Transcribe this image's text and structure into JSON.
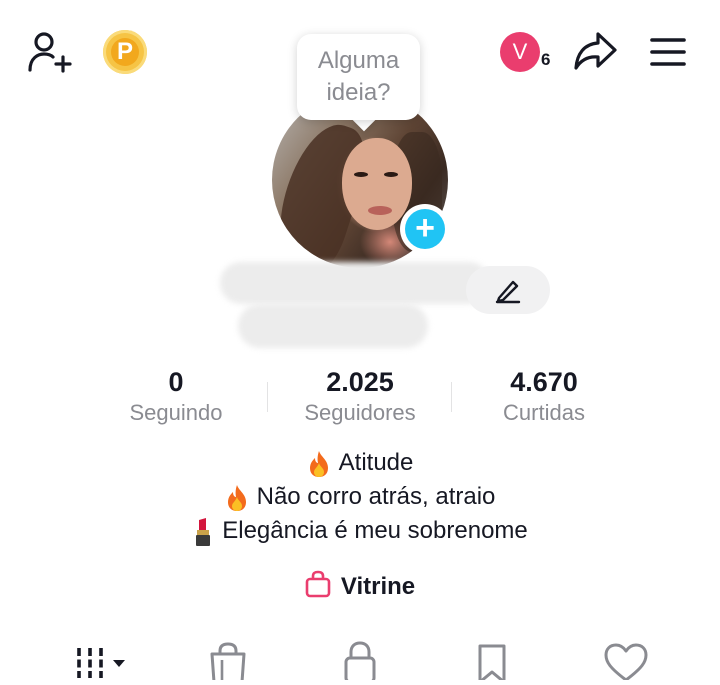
{
  "header": {
    "points_label": "P",
    "visitor_initial": "V",
    "visitor_count": "6"
  },
  "bubble": {
    "text_line1": "Alguma",
    "text_line2": "ideia?"
  },
  "stats": [
    {
      "value": "0",
      "label": "Seguindo"
    },
    {
      "value": "2.025",
      "label": "Seguidores"
    },
    {
      "value": "4.670",
      "label": "Curtidas"
    }
  ],
  "bio": [
    {
      "emoji": "fire-emoji",
      "text": "Atitude"
    },
    {
      "emoji": "fire-emoji",
      "text": "Não corro atrás, atraio"
    },
    {
      "emoji": "lipstick-emoji",
      "text": "Elegância é meu sobrenome"
    }
  ],
  "showcase": {
    "label": "Vitrine",
    "icon": "shopping-bag-icon"
  },
  "colors": {
    "accent_pink": "#ea3d6e",
    "accent_cyan": "#20c4f4",
    "coin": "#f6c445",
    "text_primary": "#161823",
    "text_secondary": "#8a8b91"
  },
  "tabs": [
    {
      "icon": "grid-videos-icon"
    },
    {
      "icon": "shopping-bag-icon"
    },
    {
      "icon": "lock-icon"
    },
    {
      "icon": "bookmark-icon"
    },
    {
      "icon": "heart-icon"
    }
  ]
}
